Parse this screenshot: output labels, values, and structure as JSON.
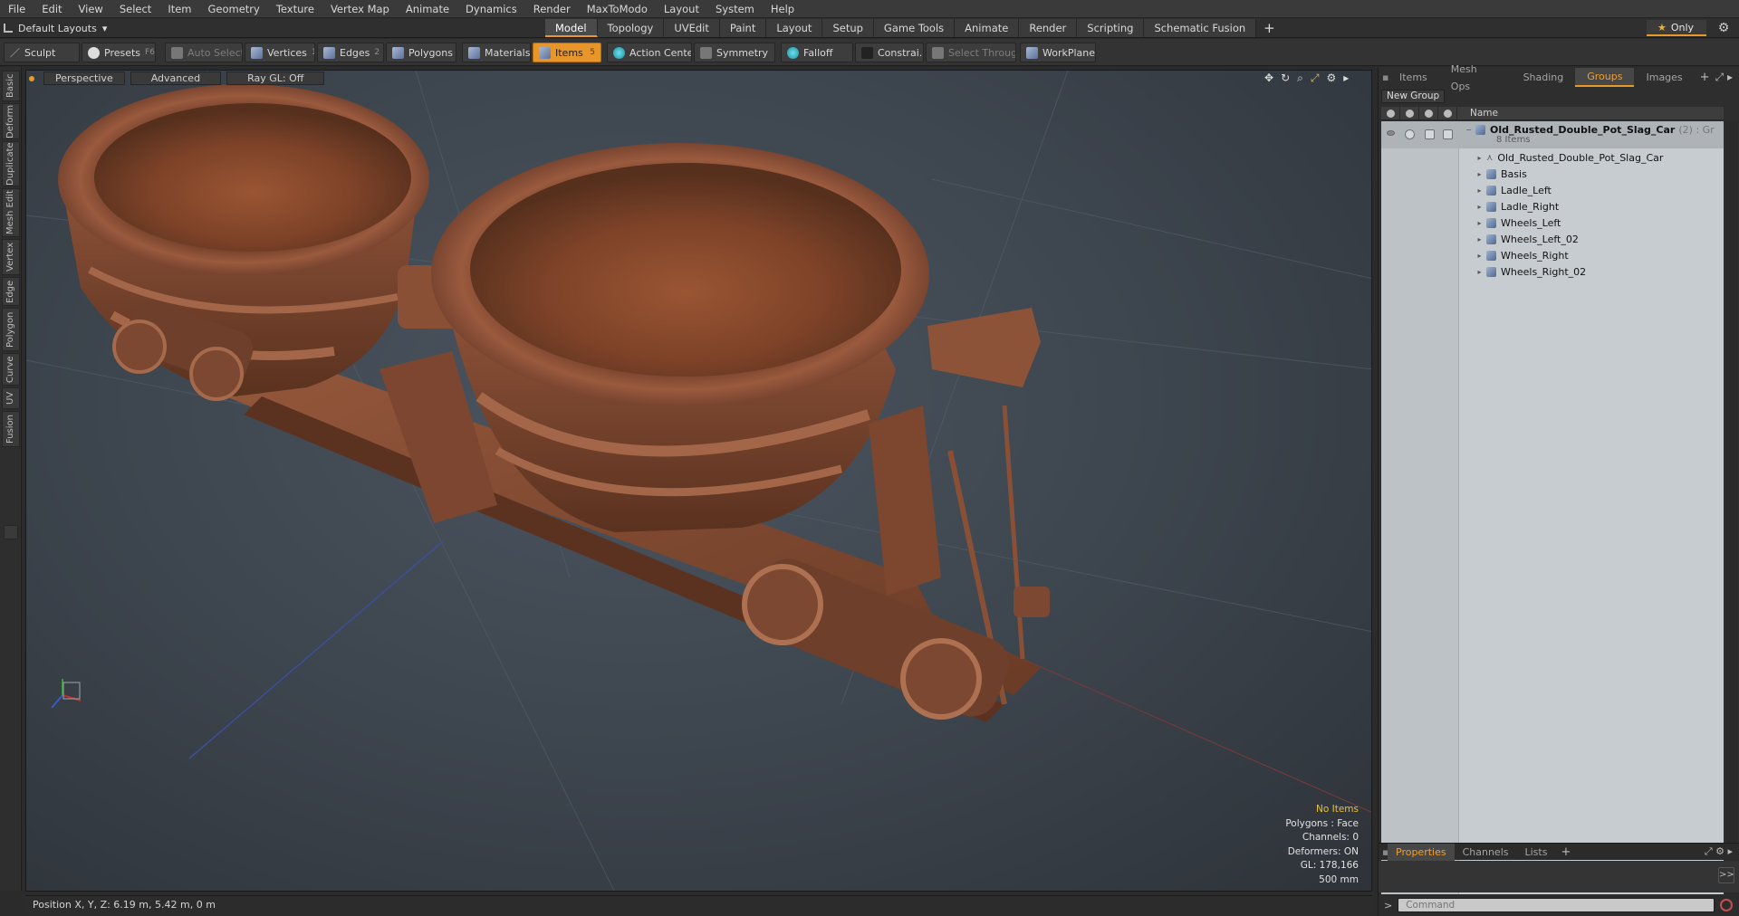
{
  "menu": [
    "File",
    "Edit",
    "View",
    "Select",
    "Item",
    "Geometry",
    "Texture",
    "Vertex Map",
    "Animate",
    "Dynamics",
    "Render",
    "MaxToModo",
    "Layout",
    "System",
    "Help"
  ],
  "layout_selector": "Default Layouts",
  "mode_tabs": [
    "Model",
    "Topology",
    "UVEdit",
    "Paint",
    "Layout",
    "Setup",
    "Game Tools",
    "Animate",
    "Render",
    "Scripting",
    "Schematic Fusion"
  ],
  "active_mode": "Model",
  "only_label": "Only",
  "toolbar": {
    "sculpt": "Sculpt",
    "presets": "Presets",
    "presets_key": "F6",
    "auto_select": "Auto Select",
    "vertices": "Vertices",
    "vertices_key": "1",
    "edges": "Edges",
    "edges_key": "2",
    "polygons": "Polygons",
    "materials": "Materials",
    "items": "Items",
    "items_key": "5",
    "action_center": "Action Center",
    "symmetry": "Symmetry",
    "falloff": "Falloff",
    "constrain": "Constrai...",
    "select_through": "Select Through",
    "workplane": "WorkPlane"
  },
  "left_tabs": [
    "Basic",
    "Deform",
    "Duplicate",
    "Mesh Edit",
    "Vertex",
    "Edge",
    "Polygon",
    "Curve",
    "UV",
    "Fusion"
  ],
  "viewport": {
    "view_mode": "Perspective",
    "shading": "Advanced",
    "raygl": "Ray GL: Off",
    "info": {
      "selection": "No Items",
      "polygons": "Polygons : Face",
      "channels": "Channels: 0",
      "deformers": "Deformers: ON",
      "gl": "GL: 178,166",
      "scale": "500 mm"
    }
  },
  "status": "Position X, Y, Z:   6.19 m, 5.42 m, 0 m",
  "right_panel": {
    "tabs": [
      "Items",
      "Mesh Ops",
      "Shading",
      "Groups",
      "Images"
    ],
    "active_tab": "Groups",
    "new_group": "New Group",
    "column_name": "Name",
    "group": {
      "name": "Old_Rusted_Double_Pot_Slag_Car",
      "count": "(2) : Gr",
      "sub": "8 Items"
    },
    "items": [
      "Old_Rusted_Double_Pot_Slag_Car",
      "Basis",
      "Ladle_Left",
      "Ladle_Right",
      "Wheels_Left",
      "Wheels_Left_02",
      "Wheels_Right",
      "Wheels_Right_02"
    ],
    "bottom_tabs": [
      "Properties",
      "Channels",
      "Lists"
    ],
    "active_bottom_tab": "Properties",
    "command_placeholder": "Command"
  },
  "colors": {
    "accent": "#e89a28",
    "rust": "#8a4f35",
    "list_bg": "#c7ccd1"
  }
}
